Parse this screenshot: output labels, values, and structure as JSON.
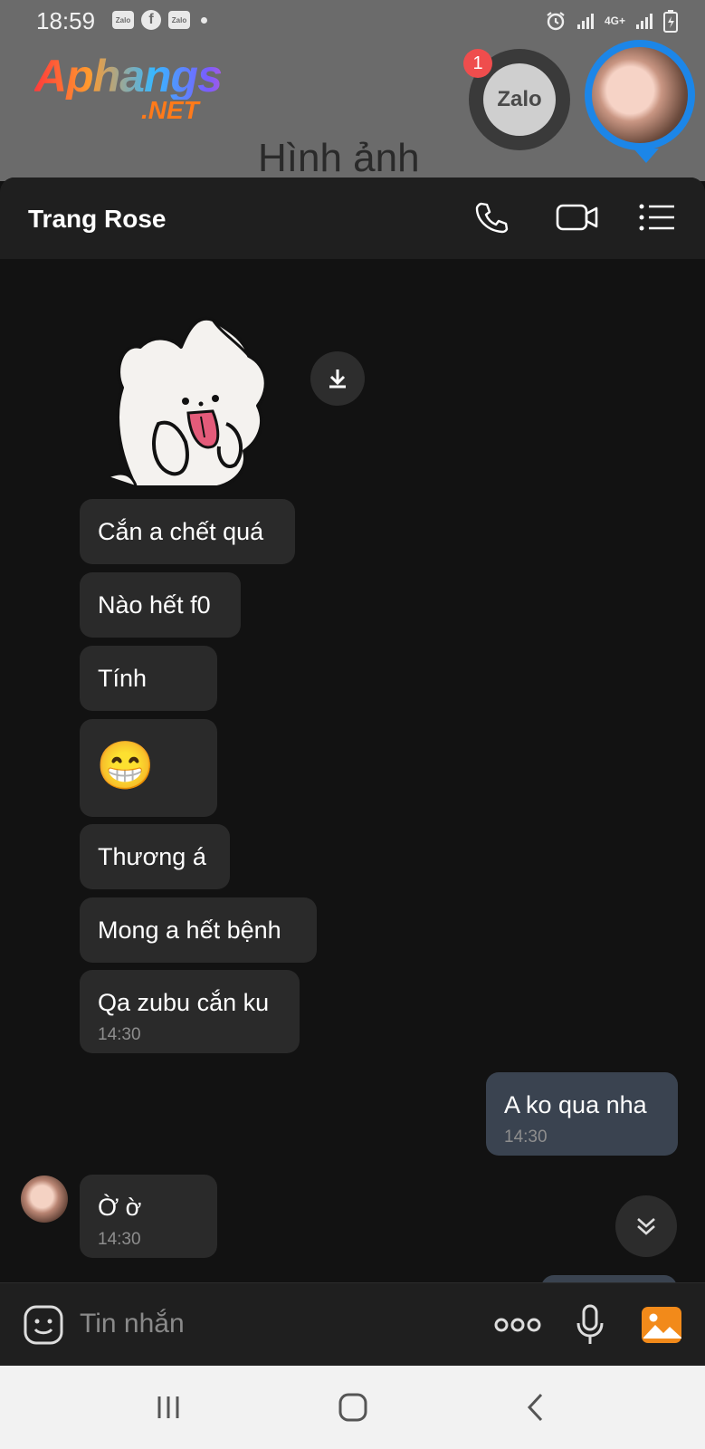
{
  "status_bar": {
    "time": "18:59",
    "notification_icons": [
      "Zalo",
      "Zalo"
    ],
    "network": "4G+"
  },
  "overlay": {
    "watermark_main": "Aphangs",
    "watermark_sub": ".NET",
    "background_title": "Hình ảnh",
    "zalo_bubble_label": "Zalo",
    "zalo_badge_count": "1"
  },
  "chat": {
    "contact_name": "Trang Rose",
    "messages": [
      {
        "text": "Cắn a chết quá"
      },
      {
        "text": "Nào hết f0"
      },
      {
        "text": "Tính"
      },
      {
        "text": "😁"
      },
      {
        "text": "Thương á"
      },
      {
        "text": "Mong a hết bệnh"
      },
      {
        "text": "Qa zubu cắn ku",
        "time": "14:30"
      },
      {
        "text": "A ko qua nha",
        "time": "14:30",
        "outgoing": true
      },
      {
        "text": "Ờ ờ",
        "time": "14:30"
      }
    ]
  },
  "input": {
    "placeholder": "Tin nhắn"
  },
  "colors": {
    "incoming_bubble": "#2a2a2a",
    "outgoing_bubble": "#3a4350",
    "accent_blue": "#1c86e8",
    "badge_red": "#ef4d4d",
    "gallery_orange": "#f28a1a"
  }
}
